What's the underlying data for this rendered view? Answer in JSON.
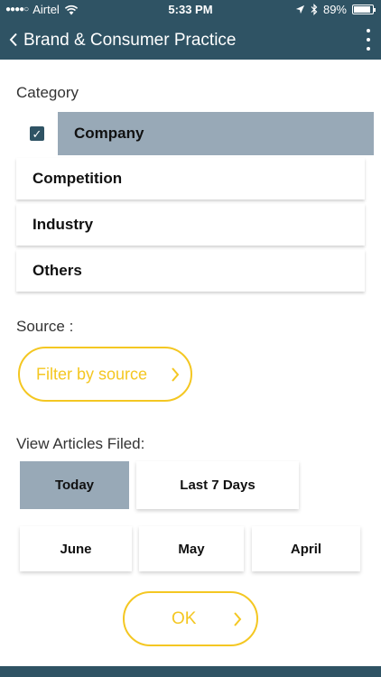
{
  "status_bar": {
    "signal_dots": "●●●●○",
    "carrier": "Airtel",
    "time": "5:33 PM",
    "battery": "89%",
    "battery_level": 0.89
  },
  "header": {
    "title": "Brand & Consumer Practice"
  },
  "category": {
    "label": "Category",
    "items": [
      {
        "label": "Company",
        "selected": true
      },
      {
        "label": "Competition",
        "selected": false
      },
      {
        "label": "Industry",
        "selected": false
      },
      {
        "label": "Others",
        "selected": false
      }
    ]
  },
  "source": {
    "label": "Source :",
    "filter_button": "Filter by source"
  },
  "view_articles": {
    "label": "View Articles Filed:",
    "options": [
      {
        "label": "Today",
        "selected": true
      },
      {
        "label": "Last 7 Days",
        "selected": false
      },
      {
        "label": "June",
        "selected": false
      },
      {
        "label": "May",
        "selected": false
      },
      {
        "label": "April",
        "selected": false
      }
    ]
  },
  "ok_button": "OK",
  "colors": {
    "primary": "#2f5364",
    "selected": "#98a9b7",
    "accent": "#f4c722"
  }
}
